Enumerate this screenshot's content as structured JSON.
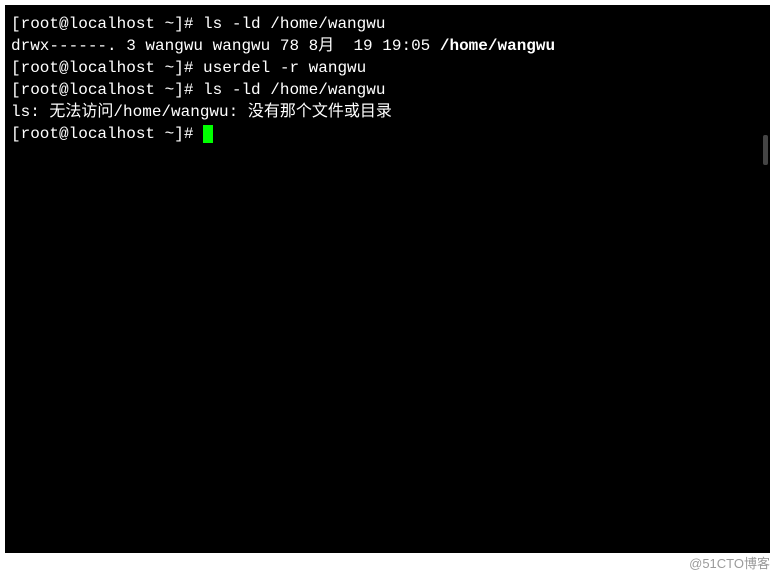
{
  "terminal": {
    "lines": [
      {
        "prompt": "[root@localhost ~]# ",
        "command": "ls -ld /home/wangwu"
      },
      {
        "output": "drwx------. 3 wangwu wangwu 78 8月  19 19:05 ",
        "highlight": "/home/wangwu"
      },
      {
        "prompt": "[root@localhost ~]# ",
        "command": "userdel -r wangwu"
      },
      {
        "prompt": "[root@localhost ~]# ",
        "command": "ls -ld /home/wangwu"
      },
      {
        "output": "ls: 无法访问/home/wangwu: 没有那个文件或目录"
      },
      {
        "prompt": "[root@localhost ~]# ",
        "command": "",
        "cursor": true
      }
    ]
  },
  "watermark": "@51CTO博客"
}
